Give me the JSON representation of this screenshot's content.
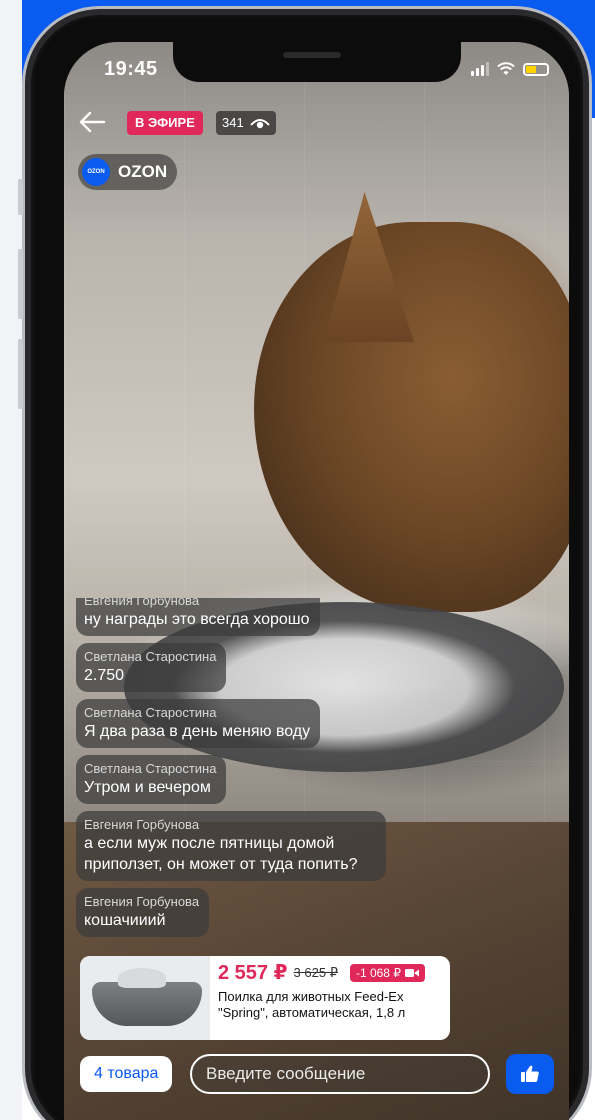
{
  "colors": {
    "brand_blue": "#0a5bf0",
    "live_red": "#e0285a"
  },
  "status_bar": {
    "time": "19:45"
  },
  "stream": {
    "live_label": "В ЭФИРЕ",
    "viewers": "341",
    "channel_logo_text": "OZON",
    "channel_name": "OZON"
  },
  "chat": {
    "messages": [
      {
        "author": "Евгения Горбунова",
        "text": "ну награды это всегда хорошо"
      },
      {
        "author": "Светлана Старостина",
        "text": "2.750"
      },
      {
        "author": "Светлана Старостина",
        "text": "Я два раза в день меняю воду"
      },
      {
        "author": "Светлана Старостина",
        "text": "Утром и вечером"
      },
      {
        "author": "Евгения Горбунова",
        "text": "а если муж после пятницы домой приползет, он может от туда попить?"
      },
      {
        "author": "Евгения Горбунова",
        "text": "кошачииий"
      }
    ]
  },
  "product": {
    "price": "2 557 ₽",
    "old_price": "3 625 ₽",
    "discount": "-1 068 ₽",
    "title": "Поилка для животных Feed-Ex \"Spring\", автоматическая, 1,8 л"
  },
  "bottom_bar": {
    "goods_button": "4 товара",
    "input_placeholder": "Введите сообщение"
  },
  "icons": [
    "back-arrow-icon",
    "eye-icon",
    "signal-icon",
    "wifi-icon",
    "battery-icon",
    "video-icon",
    "thumbs-up-icon"
  ]
}
